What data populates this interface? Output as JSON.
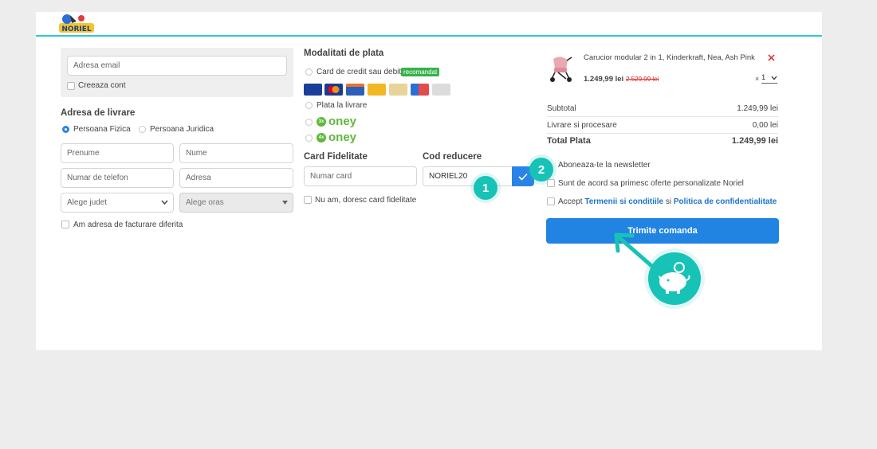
{
  "brand": {
    "logo_text": "NORIEL",
    "accent": "#2fc7d0",
    "primary": "#2184e3",
    "teal": "#17c3b6"
  },
  "account": {
    "email_placeholder": "Adresa email",
    "create_account": "Creeaza cont"
  },
  "delivery": {
    "title": "Adresa de livrare",
    "person_physical": "Persoana Fizica",
    "person_legal": "Persoana Juridica",
    "first_name_placeholder": "Prenume",
    "last_name_placeholder": "Nume",
    "phone_placeholder": "Numar de telefon",
    "address_placeholder": "Adresa",
    "county_value": "Alege judet",
    "city_value": "Alege oras",
    "billing_different": "Am adresa de facturare diferita"
  },
  "payment": {
    "title": "Modalitati de plata",
    "card_option": "Card de credit sau debit",
    "recommended_badge": "recomandat",
    "cash_on_delivery": "Plata la livrare",
    "oney_3x": "oney",
    "oney_4x": "oney",
    "oney_3x_badge": "3x",
    "oney_4x_badge": "4x"
  },
  "loyalty": {
    "title": "Card Fidelitate",
    "card_placeholder": "Numar card",
    "no_card": "Nu am, doresc card fidelitate"
  },
  "coupon": {
    "title": "Cod reducere",
    "value": "NORIEL20"
  },
  "steps": {
    "one": "1",
    "two": "2"
  },
  "cart": {
    "product_name": "Carucior modular 2 in 1, Kinderkraft, Nea, Ash Pink",
    "price": "1.249,99 lei",
    "old_price": "2.529,99 lei",
    "qty_prefix": "×",
    "qty": "1"
  },
  "summary": {
    "subtotal_label": "Subtotal",
    "subtotal_value": "1.249,99 lei",
    "shipping_label": "Livrare si procesare",
    "shipping_value": "0,00 lei",
    "total_label": "Total Plata",
    "total_value": "1.249,99 lei"
  },
  "consents": {
    "newsletter": "Aboneaza-te la newsletter",
    "offers": "Sunt de acord sa primesc oferte personalizate Noriel",
    "accept_prefix": "Accept",
    "terms": "Termenii si conditiile",
    "and": "si",
    "privacy": "Politica de confidentialitate"
  },
  "submit_label": "Trimite comanda",
  "icons": {
    "remove": "close-icon",
    "check": "check-icon",
    "piggy": "piggy-bank-icon",
    "arrow": "arrow-pointer-icon"
  }
}
